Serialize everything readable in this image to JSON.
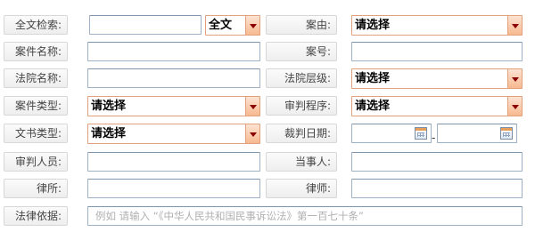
{
  "form": {
    "fulltext": {
      "label": "全文检索:",
      "scope": "全文"
    },
    "cause": {
      "label": "案由:",
      "value": "请选择"
    },
    "case_name": {
      "label": "案件名称:"
    },
    "case_no": {
      "label": "案号:"
    },
    "court_name": {
      "label": "法院名称:"
    },
    "court_level": {
      "label": "法院层级:",
      "value": "请选择"
    },
    "case_type": {
      "label": "案件类型:",
      "value": "请选择"
    },
    "procedure": {
      "label": "审判程序:",
      "value": "请选择"
    },
    "doc_type": {
      "label": "文书类型:",
      "value": "请选择"
    },
    "judge_date": {
      "label": "裁判日期:",
      "separator": "-"
    },
    "judges": {
      "label": "审判人员:"
    },
    "parties": {
      "label": "当事人:"
    },
    "law_firm": {
      "label": "律所:"
    },
    "lawyer": {
      "label": "律师:"
    },
    "legal_basis": {
      "label": "法律依据:",
      "placeholder": "例如  请输入 “《中华人民共和国民事诉讼法》第一百七十条”"
    }
  }
}
